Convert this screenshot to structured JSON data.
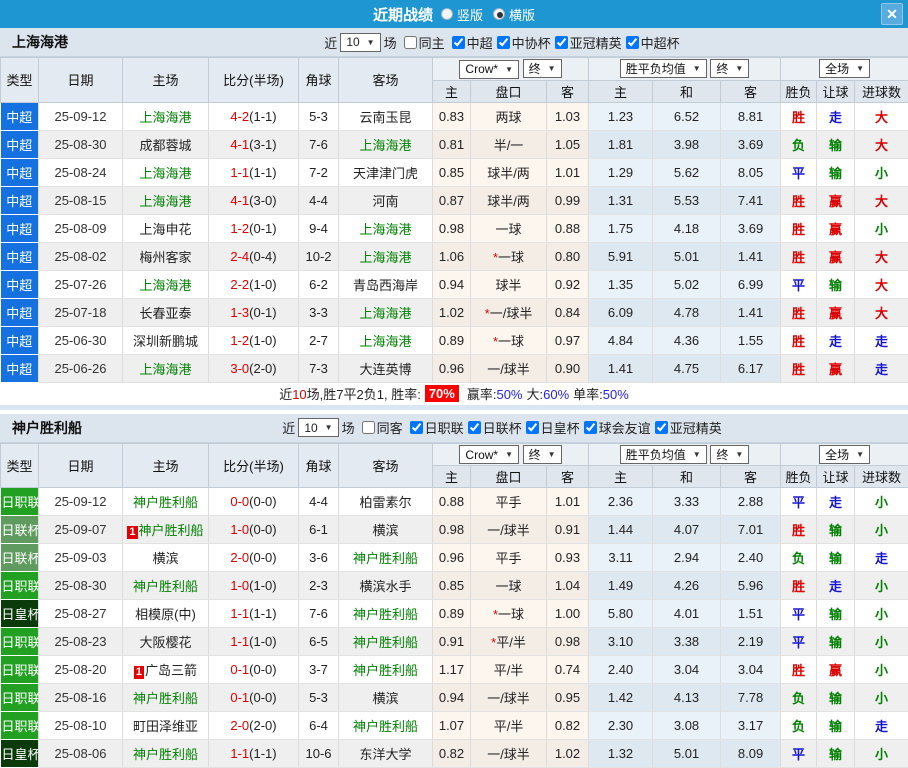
{
  "topbar": {
    "title": "近期战绩",
    "radios": [
      {
        "label": "竖版",
        "checked": false
      },
      {
        "label": "横版",
        "checked": true
      }
    ],
    "close_icon": "✕"
  },
  "table_header": {
    "type": "类型",
    "date": "日期",
    "home": "主场",
    "score": "比分(半场)",
    "corner": "角球",
    "away": "客场",
    "dd_company": "Crow*",
    "dd_final": "终",
    "dd_avg": "胜平负均值",
    "dd_full": "全场",
    "sub": {
      "h_home": "主",
      "h_handicap": "盘口",
      "h_away": "客",
      "a_home": "主",
      "a_draw": "和",
      "a_away": "客",
      "r_wdl": "胜负",
      "r_handicap": "让球",
      "r_goals": "进球数"
    }
  },
  "colors": {
    "topbar_blue": "#1E96D2",
    "type_csl_blue": "#1570E0",
    "type_j1_green": "#21A021",
    "type_jlc_green": "#5F9B5F",
    "type_jec_darkgreen": "#0B3B0B",
    "win_red": "#DD0000",
    "lose_green": "#008000",
    "draw_blue": "#1515CD",
    "self_team_green": "#008000",
    "rate_badge_red": "#FF0000",
    "result_class_map": {
      "胜": "red",
      "赢": "red",
      "大": "red",
      "负": "green",
      "输": "green",
      "小": "green",
      "平": "blue",
      "走": "blue"
    }
  },
  "sections": [
    {
      "title": "上海海港",
      "filters": {
        "recent_label": "近",
        "count": "10",
        "games_label": "场",
        "same_label": "同主",
        "same_checked": false,
        "leagues": [
          {
            "label": "中超",
            "checked": true
          },
          {
            "label": "中协杯",
            "checked": true
          },
          {
            "label": "亚冠精英",
            "checked": true
          },
          {
            "label": "中超杯",
            "checked": true
          }
        ]
      },
      "rows": [
        {
          "type": "中超",
          "type_class": "csl",
          "date": "25-09-12",
          "home": "上海海港",
          "home_self": true,
          "home_badge": "",
          "score": "4-2",
          "half": "(1-1)",
          "corner": "5-3",
          "away": "云南玉昆",
          "away_self": false,
          "away_badge": "",
          "water_home": "0.83",
          "handicap": "两球",
          "water_away": "1.03",
          "avg_home": "1.23",
          "avg_draw": "6.52",
          "avg_away": "8.81",
          "res_wdl": "胜",
          "res_handicap": "走",
          "res_goals": "大"
        },
        {
          "type": "中超",
          "type_class": "csl",
          "date": "25-08-30",
          "home": "成都蓉城",
          "home_self": false,
          "home_badge": "",
          "score": "4-1",
          "half": "(3-1)",
          "corner": "7-6",
          "away": "上海海港",
          "away_self": true,
          "away_badge": "",
          "water_home": "0.81",
          "handicap": "半/一",
          "water_away": "1.05",
          "avg_home": "1.81",
          "avg_draw": "3.98",
          "avg_away": "3.69",
          "res_wdl": "负",
          "res_handicap": "输",
          "res_goals": "大"
        },
        {
          "type": "中超",
          "type_class": "csl",
          "date": "25-08-24",
          "home": "上海海港",
          "home_self": true,
          "home_badge": "",
          "score": "1-1",
          "half": "(1-1)",
          "corner": "7-2",
          "away": "天津津门虎",
          "away_self": false,
          "away_badge": "",
          "water_home": "0.85",
          "handicap": "球半/两",
          "water_away": "1.01",
          "avg_home": "1.29",
          "avg_draw": "5.62",
          "avg_away": "8.05",
          "res_wdl": "平",
          "res_handicap": "输",
          "res_goals": "小"
        },
        {
          "type": "中超",
          "type_class": "csl",
          "date": "25-08-15",
          "home": "上海海港",
          "home_self": true,
          "home_badge": "",
          "score": "4-1",
          "half": "(3-0)",
          "corner": "4-4",
          "away": "河南",
          "away_self": false,
          "away_badge": "",
          "water_home": "0.87",
          "handicap": "球半/两",
          "water_away": "0.99",
          "avg_home": "1.31",
          "avg_draw": "5.53",
          "avg_away": "7.41",
          "res_wdl": "胜",
          "res_handicap": "赢",
          "res_goals": "大"
        },
        {
          "type": "中超",
          "type_class": "csl",
          "date": "25-08-09",
          "home": "上海申花",
          "home_self": false,
          "home_badge": "",
          "score": "1-2",
          "half": "(0-1)",
          "corner": "9-4",
          "away": "上海海港",
          "away_self": true,
          "away_badge": "",
          "water_home": "0.98",
          "handicap": "一球",
          "water_away": "0.88",
          "avg_home": "1.75",
          "avg_draw": "4.18",
          "avg_away": "3.69",
          "res_wdl": "胜",
          "res_handicap": "赢",
          "res_goals": "小"
        },
        {
          "type": "中超",
          "type_class": "csl",
          "date": "25-08-02",
          "home": "梅州客家",
          "home_self": false,
          "home_badge": "",
          "score": "2-4",
          "half": "(0-4)",
          "corner": "10-2",
          "away": "上海海港",
          "away_self": true,
          "away_badge": "",
          "water_home": "1.06",
          "handicap": "*一球",
          "water_away": "0.80",
          "avg_home": "5.91",
          "avg_draw": "5.01",
          "avg_away": "1.41",
          "res_wdl": "胜",
          "res_handicap": "赢",
          "res_goals": "大"
        },
        {
          "type": "中超",
          "type_class": "csl",
          "date": "25-07-26",
          "home": "上海海港",
          "home_self": true,
          "home_badge": "",
          "score": "2-2",
          "half": "(1-0)",
          "corner": "6-2",
          "away": "青岛西海岸",
          "away_self": false,
          "away_badge": "",
          "water_home": "0.94",
          "handicap": "球半",
          "water_away": "0.92",
          "avg_home": "1.35",
          "avg_draw": "5.02",
          "avg_away": "6.99",
          "res_wdl": "平",
          "res_handicap": "输",
          "res_goals": "大"
        },
        {
          "type": "中超",
          "type_class": "csl",
          "date": "25-07-18",
          "home": "长春亚泰",
          "home_self": false,
          "home_badge": "",
          "score": "1-3",
          "half": "(0-1)",
          "corner": "3-3",
          "away": "上海海港",
          "away_self": true,
          "away_badge": "",
          "water_home": "1.02",
          "handicap": "*一/球半",
          "water_away": "0.84",
          "avg_home": "6.09",
          "avg_draw": "4.78",
          "avg_away": "1.41",
          "res_wdl": "胜",
          "res_handicap": "赢",
          "res_goals": "大"
        },
        {
          "type": "中超",
          "type_class": "csl",
          "date": "25-06-30",
          "home": "深圳新鹏城",
          "home_self": false,
          "home_badge": "",
          "score": "1-2",
          "half": "(1-0)",
          "corner": "2-7",
          "away": "上海海港",
          "away_self": true,
          "away_badge": "",
          "water_home": "0.89",
          "handicap": "*一球",
          "water_away": "0.97",
          "avg_home": "4.84",
          "avg_draw": "4.36",
          "avg_away": "1.55",
          "res_wdl": "胜",
          "res_handicap": "走",
          "res_goals": "走"
        },
        {
          "type": "中超",
          "type_class": "csl",
          "date": "25-06-26",
          "home": "上海海港",
          "home_self": true,
          "home_badge": "",
          "score": "3-0",
          "half": "(2-0)",
          "corner": "7-3",
          "away": "大连英博",
          "away_self": false,
          "away_badge": "",
          "water_home": "0.96",
          "handicap": "一/球半",
          "water_away": "0.90",
          "avg_home": "1.41",
          "avg_draw": "4.75",
          "avg_away": "6.17",
          "res_wdl": "胜",
          "res_handicap": "赢",
          "res_goals": "走"
        }
      ],
      "summary": {
        "text_before_num": "近",
        "num": "10",
        "text_after_num": "场,胜7平2负1, 胜率:",
        "win_rate": "70%",
        "stats": [
          {
            "label": "赢率:",
            "value": "50%"
          },
          {
            "label": "大:",
            "value": "60%"
          },
          {
            "label": "单率:",
            "value": "50%"
          }
        ]
      }
    },
    {
      "title": "神户胜利船",
      "filters": {
        "recent_label": "近",
        "count": "10",
        "games_label": "场",
        "same_label": "同客",
        "same_checked": false,
        "leagues": [
          {
            "label": "日职联",
            "checked": true
          },
          {
            "label": "日联杯",
            "checked": true
          },
          {
            "label": "日皇杯",
            "checked": true
          },
          {
            "label": "球会友谊",
            "checked": true
          },
          {
            "label": "亚冠精英",
            "checked": true
          }
        ]
      },
      "rows": [
        {
          "type": "日职联",
          "type_class": "j1",
          "date": "25-09-12",
          "home": "神户胜利船",
          "home_self": true,
          "home_badge": "",
          "score": "0-0",
          "half": "(0-0)",
          "corner": "4-4",
          "away": "柏雷素尔",
          "away_self": false,
          "away_badge": "",
          "water_home": "0.88",
          "handicap": "平手",
          "water_away": "1.01",
          "avg_home": "2.36",
          "avg_draw": "3.33",
          "avg_away": "2.88",
          "res_wdl": "平",
          "res_handicap": "走",
          "res_goals": "小"
        },
        {
          "type": "日联杯",
          "type_class": "jlc",
          "date": "25-09-07",
          "home": "神户胜利船",
          "home_self": true,
          "home_badge": "1",
          "score": "1-0",
          "half": "(0-0)",
          "corner": "6-1",
          "away": "横滨",
          "away_self": false,
          "away_badge": "",
          "water_home": "0.98",
          "handicap": "一/球半",
          "water_away": "0.91",
          "avg_home": "1.44",
          "avg_draw": "4.07",
          "avg_away": "7.01",
          "res_wdl": "胜",
          "res_handicap": "输",
          "res_goals": "小"
        },
        {
          "type": "日联杯",
          "type_class": "jlc",
          "date": "25-09-03",
          "home": "横滨",
          "home_self": false,
          "home_badge": "",
          "score": "2-0",
          "half": "(0-0)",
          "corner": "3-6",
          "away": "神户胜利船",
          "away_self": true,
          "away_badge": "",
          "water_home": "0.96",
          "handicap": "平手",
          "water_away": "0.93",
          "avg_home": "3.11",
          "avg_draw": "2.94",
          "avg_away": "2.40",
          "res_wdl": "负",
          "res_handicap": "输",
          "res_goals": "走"
        },
        {
          "type": "日职联",
          "type_class": "j1",
          "date": "25-08-30",
          "home": "神户胜利船",
          "home_self": true,
          "home_badge": "",
          "score": "1-0",
          "half": "(1-0)",
          "corner": "2-3",
          "away": "横滨水手",
          "away_self": false,
          "away_badge": "",
          "water_home": "0.85",
          "handicap": "一球",
          "water_away": "1.04",
          "avg_home": "1.49",
          "avg_draw": "4.26",
          "avg_away": "5.96",
          "res_wdl": "胜",
          "res_handicap": "走",
          "res_goals": "小"
        },
        {
          "type": "日皇杯",
          "type_class": "jec",
          "date": "25-08-27",
          "home": "相模原(中)",
          "home_self": false,
          "home_badge": "",
          "score": "1-1",
          "half": "(1-1)",
          "corner": "7-6",
          "away": "神户胜利船",
          "away_self": true,
          "away_badge": "",
          "water_home": "0.89",
          "handicap": "*一球",
          "water_away": "1.00",
          "avg_home": "5.80",
          "avg_draw": "4.01",
          "avg_away": "1.51",
          "res_wdl": "平",
          "res_handicap": "输",
          "res_goals": "小"
        },
        {
          "type": "日职联",
          "type_class": "j1",
          "date": "25-08-23",
          "home": "大阪樱花",
          "home_self": false,
          "home_badge": "",
          "score": "1-1",
          "half": "(1-0)",
          "corner": "6-5",
          "away": "神户胜利船",
          "away_self": true,
          "away_badge": "",
          "water_home": "0.91",
          "handicap": "*平/半",
          "water_away": "0.98",
          "avg_home": "3.10",
          "avg_draw": "3.38",
          "avg_away": "2.19",
          "res_wdl": "平",
          "res_handicap": "输",
          "res_goals": "小"
        },
        {
          "type": "日职联",
          "type_class": "j1",
          "date": "25-08-20",
          "home": "广岛三箭",
          "home_self": false,
          "home_badge": "1",
          "score": "0-1",
          "half": "(0-0)",
          "corner": "3-7",
          "away": "神户胜利船",
          "away_self": true,
          "away_badge": "",
          "water_home": "1.17",
          "handicap": "平/半",
          "water_away": "0.74",
          "avg_home": "2.40",
          "avg_draw": "3.04",
          "avg_away": "3.04",
          "res_wdl": "胜",
          "res_handicap": "赢",
          "res_goals": "小"
        },
        {
          "type": "日职联",
          "type_class": "j1",
          "date": "25-08-16",
          "home": "神户胜利船",
          "home_self": true,
          "home_badge": "",
          "score": "0-1",
          "half": "(0-0)",
          "corner": "5-3",
          "away": "横滨",
          "away_self": false,
          "away_badge": "",
          "water_home": "0.94",
          "handicap": "一/球半",
          "water_away": "0.95",
          "avg_home": "1.42",
          "avg_draw": "4.13",
          "avg_away": "7.78",
          "res_wdl": "负",
          "res_handicap": "输",
          "res_goals": "小"
        },
        {
          "type": "日职联",
          "type_class": "j1",
          "date": "25-08-10",
          "home": "町田泽维亚",
          "home_self": false,
          "home_badge": "",
          "score": "2-0",
          "half": "(2-0)",
          "corner": "6-4",
          "away": "神户胜利船",
          "away_self": true,
          "away_badge": "",
          "water_home": "1.07",
          "handicap": "平/半",
          "water_away": "0.82",
          "avg_home": "2.30",
          "avg_draw": "3.08",
          "avg_away": "3.17",
          "res_wdl": "负",
          "res_handicap": "输",
          "res_goals": "走"
        },
        {
          "type": "日皇杯",
          "type_class": "jec",
          "date": "25-08-06",
          "home": "神户胜利船",
          "home_self": true,
          "home_badge": "",
          "score": "1-1",
          "half": "(1-1)",
          "corner": "10-6",
          "away": "东洋大学",
          "away_self": false,
          "away_badge": "",
          "water_home": "0.82",
          "handicap": "一/球半",
          "water_away": "1.02",
          "avg_home": "1.32",
          "avg_draw": "5.01",
          "avg_away": "8.09",
          "res_wdl": "平",
          "res_handicap": "输",
          "res_goals": "小"
        }
      ],
      "summary": null
    }
  ]
}
